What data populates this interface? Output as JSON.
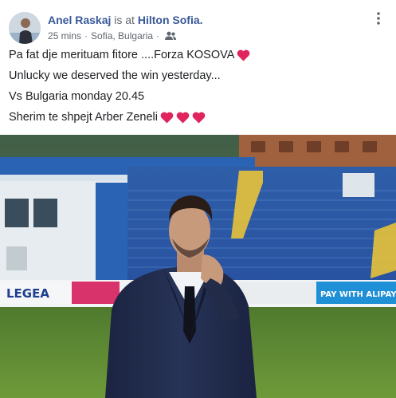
{
  "post": {
    "author": "Anel Raskaj",
    "checkin_prefix": "is at",
    "place": "Hilton Sofia.",
    "timestamp": "25 mins",
    "separator": "·",
    "location": "Sofia, Bulgaria",
    "audience_icon": "friends-icon",
    "more_icon": "vertical-ellipsis-icon",
    "lines": [
      "Pa fat dje merituam fitore ....Forza KOSOVA",
      "Unlucky we deserved the win yesterday...",
      "Vs Bulgaria monday 20.45",
      "Sherim te shpejt Arber Zeneli"
    ],
    "heart_icon": "red-heart-emoji",
    "heart_color": "#e0245e"
  },
  "photo": {
    "banner_left": "LEGEA",
    "banner_right": "PAY WITH ALIPAY",
    "description_icon": "photo-of-man-in-suit-at-stadium"
  },
  "colors": {
    "link": "#385898",
    "meta": "#616770",
    "text": "#1c1e21"
  }
}
